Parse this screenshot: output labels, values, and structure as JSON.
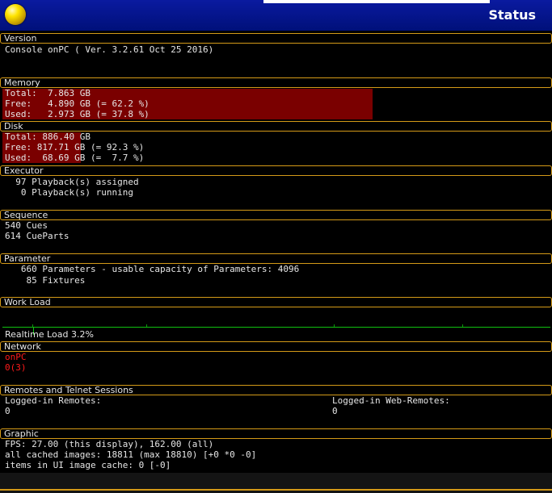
{
  "window": {
    "title": "Status"
  },
  "version": {
    "title": "Version",
    "lines": [
      "Console onPC ( Ver. 3.2.61 Oct 25 2016)"
    ]
  },
  "memory": {
    "title": "Memory",
    "lines": [
      "Total:  7.863 GB",
      "Free:   4.890 GB (= 62.2 %)",
      "Used:   2.973 GB (= 37.8 %)"
    ],
    "bar_color": "#7a0000"
  },
  "disk": {
    "title": "Disk",
    "lines": [
      "Total: 886.40 GB",
      "Free: 817.71 GB (= 92.3 %)",
      "Used:  68.69 GB (=  7.7 %)"
    ]
  },
  "executor": {
    "title": "Executor",
    "lines": [
      "  97 Playback(s) assigned",
      "   0 Playback(s) running"
    ]
  },
  "sequence": {
    "title": "Sequence",
    "lines": [
      "540 Cues",
      "614 CueParts"
    ]
  },
  "parameter": {
    "title": "Parameter",
    "lines": [
      "   660 Parameters - usable capacity of Parameters: 4096",
      "    85 Fixtures"
    ]
  },
  "workload": {
    "title": "Work Load",
    "realtime": "Realtime Load 3.2%",
    "load_percent": 3.2,
    "graph_color": "#10c010"
  },
  "network": {
    "title": "Network",
    "lines": [
      "onPC",
      "0(3)"
    ],
    "text_color": "#ff1a1a"
  },
  "remotes": {
    "title": "Remotes and Telnet Sessions",
    "left_label": "Logged-in Remotes:",
    "left_value": "0",
    "right_label": "Logged-in Web-Remotes:",
    "right_value": "0"
  },
  "graphic": {
    "title": "Graphic",
    "lines": [
      "FPS: 27.00 (this display), 162.00 (all)",
      "all cached images: 18811 (max 18810) [+0 *0 -0]",
      "items in UI image cache: 0 [-0]"
    ]
  },
  "colors": {
    "titlebar": "#00107a",
    "accent_border": "#d49a18",
    "text": "#e6e6e6"
  }
}
